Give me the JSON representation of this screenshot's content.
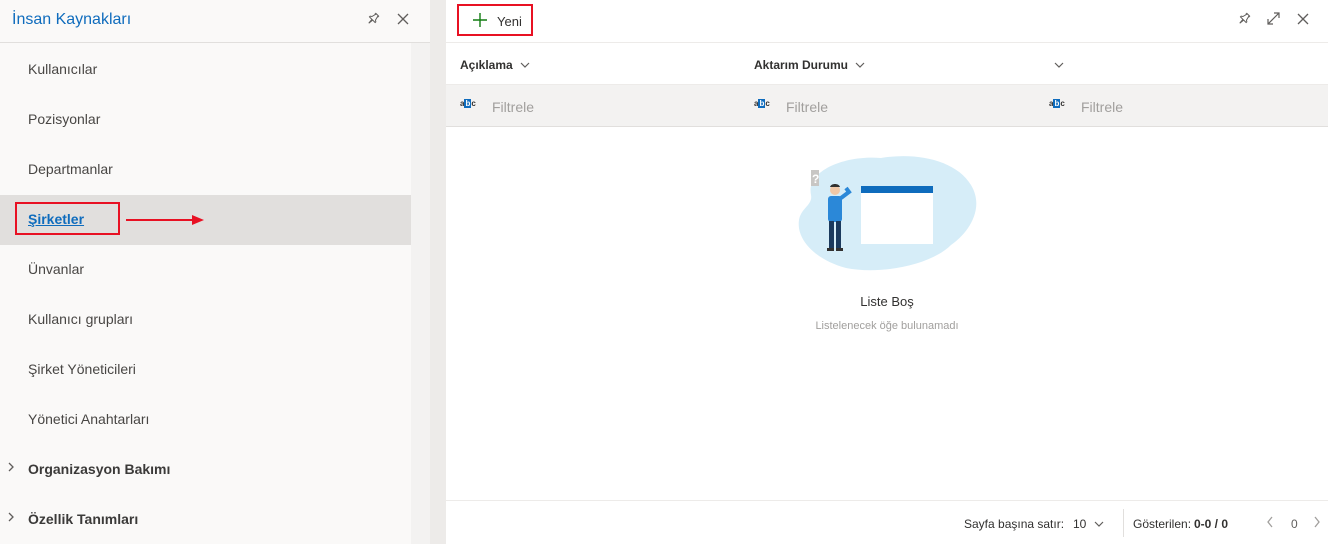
{
  "left_panel": {
    "title": "İnsan Kaynakları",
    "pin_icon": "pin-icon",
    "close_icon": "close-icon",
    "items": [
      {
        "label": "Kullanıcılar"
      },
      {
        "label": "Pozisyonlar"
      },
      {
        "label": "Departmanlar"
      },
      {
        "label": "Şirketler",
        "active": true
      },
      {
        "label": "Ünvanlar"
      },
      {
        "label": "Kullanıcı grupları"
      },
      {
        "label": "Şirket Yöneticileri"
      },
      {
        "label": "Yönetici Anahtarları"
      },
      {
        "label": "Organizasyon Bakımı",
        "group": true
      },
      {
        "label": "Özellik Tanımları",
        "group": true
      }
    ]
  },
  "toolbar": {
    "new_label": "Yeni",
    "icons": [
      "pin-icon",
      "expand-icon",
      "close-icon"
    ]
  },
  "columns": [
    {
      "label": "Açıklama"
    },
    {
      "label": "Aktarım Durumu"
    },
    {
      "label": ""
    }
  ],
  "filters": {
    "placeholder": "Filtrele",
    "type_icon": "abc-text-icon"
  },
  "empty_state": {
    "title": "Liste Boş",
    "subtitle": "Listelenecek öğe bulunamadı"
  },
  "footer": {
    "rows_per_page_label": "Sayfa başına satır:",
    "rows_per_page_value": "10",
    "showing_label": "Gösterilen:",
    "showing_value": "0-0 / 0",
    "page_number": "0"
  },
  "colors": {
    "accent": "#0f6cbd",
    "highlight": "#e81123",
    "add_icon": "#107c10"
  }
}
